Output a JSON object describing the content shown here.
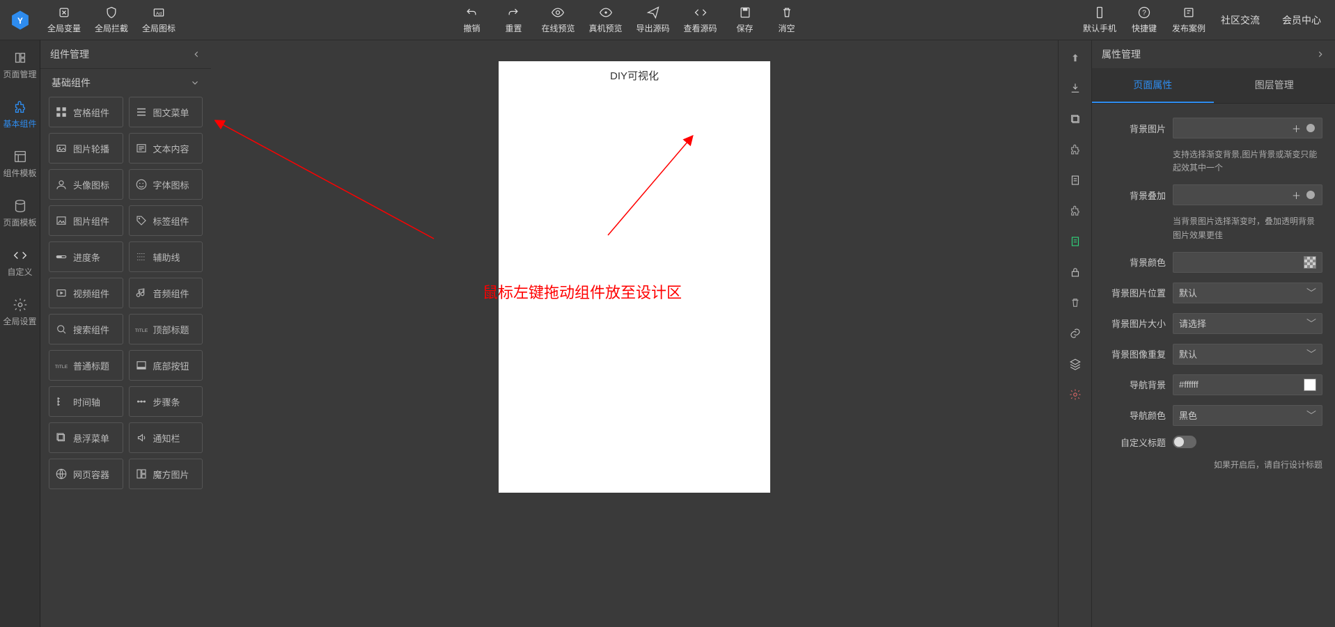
{
  "toolbar": {
    "left": [
      {
        "label": "全局变量",
        "icon": "var"
      },
      {
        "label": "全局拦截",
        "icon": "shield"
      },
      {
        "label": "全局图标",
        "icon": "ad"
      }
    ],
    "center": [
      {
        "label": "撤销",
        "icon": "undo"
      },
      {
        "label": "重置",
        "icon": "redo"
      },
      {
        "label": "在线预览",
        "icon": "eye"
      },
      {
        "label": "真机预览",
        "icon": "eye2"
      },
      {
        "label": "导出源码",
        "icon": "send"
      },
      {
        "label": "查看源码",
        "icon": "code"
      },
      {
        "label": "保存",
        "icon": "save"
      },
      {
        "label": "消空",
        "icon": "trash"
      }
    ],
    "right": [
      {
        "label": "默认手机",
        "icon": "phone"
      },
      {
        "label": "快捷键",
        "icon": "help"
      },
      {
        "label": "发布案例",
        "icon": "case"
      }
    ],
    "links": [
      "社区交流",
      "会员中心"
    ]
  },
  "leftRail": [
    {
      "label": "页面管理",
      "icon": "pages"
    },
    {
      "label": "基本组件",
      "icon": "puzzle",
      "active": true
    },
    {
      "label": "组件模板",
      "icon": "template"
    },
    {
      "label": "页面模板",
      "icon": "db"
    },
    {
      "label": "自定义",
      "icon": "code"
    },
    {
      "label": "全局设置",
      "icon": "gear"
    }
  ],
  "leftPanel": {
    "title": "组件管理",
    "section_title": "基础组件",
    "items": [
      {
        "label": "宫格组件",
        "icon": "grid"
      },
      {
        "label": "图文菜单",
        "icon": "menu"
      },
      {
        "label": "图片轮播",
        "icon": "carousel"
      },
      {
        "label": "文本内容",
        "icon": "text"
      },
      {
        "label": "头像图标",
        "icon": "avatar"
      },
      {
        "label": "字体图标",
        "icon": "smile"
      },
      {
        "label": "图片组件",
        "icon": "image"
      },
      {
        "label": "标签组件",
        "icon": "tag"
      },
      {
        "label": "进度条",
        "icon": "progress"
      },
      {
        "label": "辅助线",
        "icon": "line"
      },
      {
        "label": "视频组件",
        "icon": "video"
      },
      {
        "label": "音频组件",
        "icon": "audio"
      },
      {
        "label": "搜索组件",
        "icon": "search"
      },
      {
        "label": "顶部标题",
        "icon": "title"
      },
      {
        "label": "普通标题",
        "icon": "title2"
      },
      {
        "label": "底部按钮",
        "icon": "bottom"
      },
      {
        "label": "时间轴",
        "icon": "timeline"
      },
      {
        "label": "步骤条",
        "icon": "steps"
      },
      {
        "label": "悬浮菜单",
        "icon": "float"
      },
      {
        "label": "通知栏",
        "icon": "notice"
      },
      {
        "label": "网页容器",
        "icon": "web"
      },
      {
        "label": "魔方图片",
        "icon": "magic"
      }
    ]
  },
  "canvas": {
    "title": "DIY可视化",
    "annotation": "鼠标左键拖动组件放至设计区"
  },
  "rightPanel": {
    "title": "属性管理",
    "tabs": [
      "页面属性",
      "图层管理"
    ],
    "active_tab": 0,
    "props": {
      "bg_image_label": "背景图片",
      "bg_image_hint": "支持选择渐变背景,图片背景或渐变只能起效其中一个",
      "bg_overlay_label": "背景叠加",
      "bg_overlay_hint": "当背景图片选择渐变时，叠加透明背景图片效果更佳",
      "bg_color_label": "背景颜色",
      "bg_pos_label": "背景图片位置",
      "bg_pos_value": "默认",
      "bg_size_label": "背景图片大小",
      "bg_size_value": "请选择",
      "bg_repeat_label": "背景图像重复",
      "bg_repeat_value": "默认",
      "nav_bg_label": "导航背景",
      "nav_bg_value": "#ffffff",
      "nav_color_label": "导航颜色",
      "nav_color_value": "黑色",
      "custom_title_label": "自定义标题",
      "custom_title_hint": "如果开启后，请自行设计标题"
    }
  }
}
